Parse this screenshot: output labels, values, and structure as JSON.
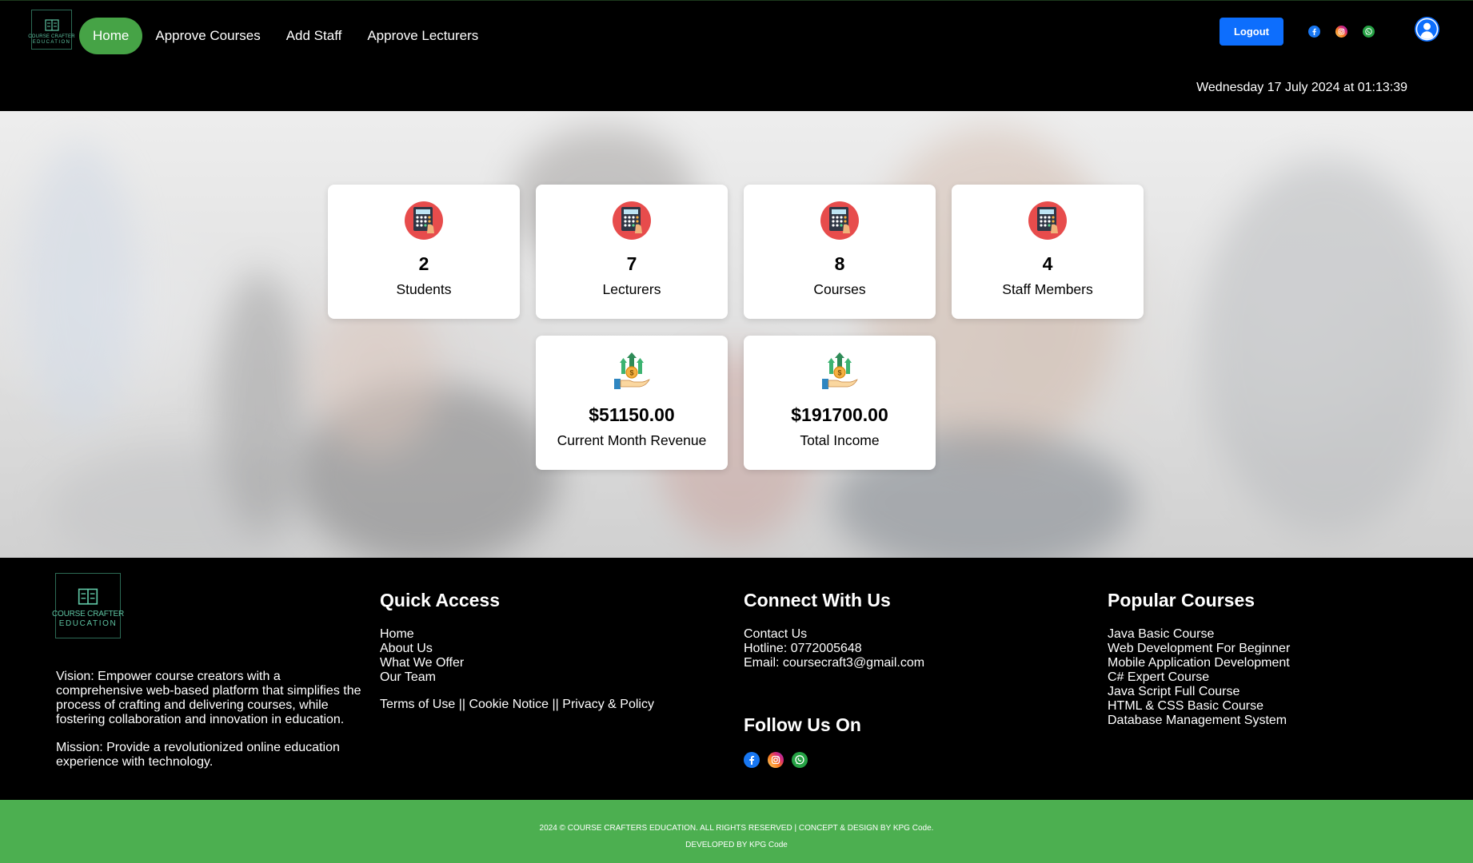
{
  "brand": {
    "logo_line1": "COURSE CRAFTER",
    "logo_line2": "EDUCATION"
  },
  "nav": {
    "items": [
      {
        "label": "Home",
        "active": true
      },
      {
        "label": "Approve Courses",
        "active": false
      },
      {
        "label": "Add Staff",
        "active": false
      },
      {
        "label": "Approve Lecturers",
        "active": false
      }
    ]
  },
  "header": {
    "logout_label": "Logout",
    "social_icons": [
      "facebook-icon",
      "instagram-icon",
      "whatsapp-icon"
    ],
    "avatar_icon": "user-avatar-icon",
    "datetime": "Wednesday 17 July 2024 at 01:13:39"
  },
  "stats": [
    {
      "value": "2",
      "label": "Students",
      "icon": "calculator-icon"
    },
    {
      "value": "7",
      "label": "Lecturers",
      "icon": "calculator-icon"
    },
    {
      "value": "8",
      "label": "Courses",
      "icon": "calculator-icon"
    },
    {
      "value": "4",
      "label": "Staff Members",
      "icon": "calculator-icon"
    },
    {
      "value": "$51150.00",
      "label": "Current Month Revenue",
      "icon": "revenue-hand-icon"
    },
    {
      "value": "$191700.00",
      "label": "Total Income",
      "icon": "revenue-hand-icon"
    }
  ],
  "footer": {
    "logo_line1": "COURSE CRAFTER",
    "logo_line2": "EDUCATION",
    "vision": "Vision: Empower course creators with a comprehensive web-based platform that simplifies the process of crafting and delivering courses, while fostering collaboration and innovation in education.",
    "mission": "Mission: Provide a revolutionized online education experience with technology.",
    "quick_access": {
      "heading": "Quick Access",
      "links": [
        "Home",
        "About Us",
        "What We Offer",
        "Our Team"
      ],
      "legal": [
        "Terms of Use",
        "Cookie Notice",
        "Privacy & Policy"
      ],
      "separator": " || "
    },
    "connect": {
      "heading": "Connect With Us",
      "lines": [
        "Contact Us",
        "Hotline: 0772005648",
        "Email: coursecraft3@gmail.com"
      ]
    },
    "follow": {
      "heading": "Follow Us On",
      "icons": [
        "facebook-icon",
        "instagram-icon",
        "whatsapp-icon"
      ]
    },
    "popular": {
      "heading": "Popular Courses",
      "courses": [
        "Java Basic Course",
        "Web Development For Beginner",
        "Mobile Application Development",
        "C# Expert Course",
        "Java Script Full Course",
        "HTML & CSS Basic Course",
        "Database Management System"
      ]
    }
  },
  "copyright": {
    "line1": "2024 © COURSE CRAFTERS EDUCATION. ALL RIGHTS RESERVED | CONCEPT & DESIGN BY KPG Code.",
    "line2": "DEVELOPED BY KPG Code"
  },
  "colors": {
    "nav_active": "#46a346",
    "logout": "#0d6efd",
    "copyright_bar": "#4caf50",
    "logo_accent": "#5ec3a2"
  }
}
